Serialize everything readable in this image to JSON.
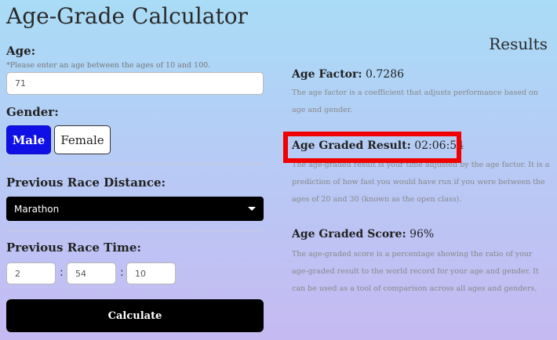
{
  "app": {
    "title": "Age-Grade Calculator"
  },
  "form": {
    "age_label": "Age:",
    "age_hint": "*Please enter an age between the ages of 10 and 100.",
    "age_value": "71",
    "gender_label": "Gender:",
    "gender_options": [
      "Male",
      "Female"
    ],
    "gender_selected": "Male",
    "distance_label": "Previous Race Distance:",
    "distance_value": "Marathon",
    "time_label": "Previous Race Time:",
    "time_hours": "2",
    "time_minutes": "54",
    "time_seconds": "10",
    "time_separator": ":",
    "calculate_label": "Calculate"
  },
  "results": {
    "title": "Results",
    "age_factor_label": "Age Factor:",
    "age_factor_value": "0.7286",
    "age_factor_desc": "The age factor is a coefficient that adjusts performance based on age and gender.",
    "graded_result_label": "Age Graded Result:",
    "graded_result_value": "02:06:54",
    "graded_result_desc": "The age-graded result is your time adjusted by the age factor. It is a prediction of how fast you would have run if you were between the ages of 20 and 30 (known as the open class).",
    "graded_score_label": "Age Graded Score:",
    "graded_score_value": "96%",
    "graded_score_desc": "The age-graded score is a percentage showing the ratio of your age-graded result to the world record for your age and gender. It can be used as a tool of comparison across all ages and genders."
  },
  "colors": {
    "male_selected": "#1010e6",
    "highlight_box": "#f00000"
  }
}
